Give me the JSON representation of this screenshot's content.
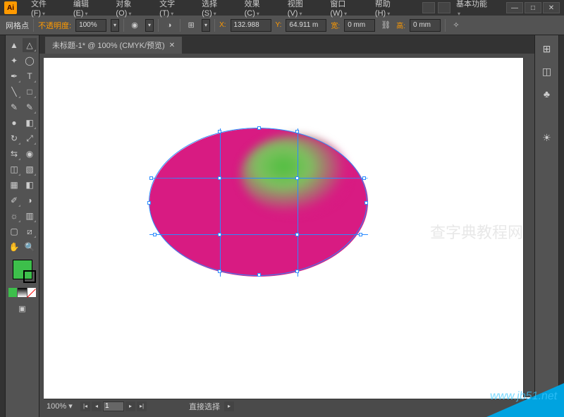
{
  "app": {
    "logo": "Ai",
    "workspace": "基本功能"
  },
  "menu": {
    "file": "文件(F)",
    "edit": "编辑(E)",
    "object": "对象(O)",
    "type": "文字(T)",
    "select": "选择(S)",
    "effect": "效果(C)",
    "view": "视图(V)",
    "window": "窗口(W)",
    "help": "帮助(H)"
  },
  "controlbar": {
    "mesh_label": "网格点",
    "opacity_label": "不透明度:",
    "opacity_value": "100%",
    "x_label": "X:",
    "x_value": "132.988",
    "y_label": "Y:",
    "y_value": "64.911 m",
    "w_label": "宽:",
    "w_value": "0 mm",
    "h_label": "高:",
    "h_value": "0 mm"
  },
  "tab": {
    "title": "未标题-1* @ 100% (CMYK/预览)"
  },
  "status": {
    "zoom": "100%",
    "artboard": "1",
    "tool": "直接选择"
  },
  "colors": {
    "fill": "#3dbf4b",
    "shape": "#d81b82",
    "mesh": "#4fbf3f"
  },
  "icons": {
    "selection": "▲",
    "direct": "△",
    "wand": "✦",
    "lasso": "◯",
    "pen": "✒",
    "type": "T",
    "line": "╲",
    "rect": "□",
    "brush": "✎",
    "pencil": "✎",
    "blob": "●",
    "eraser": "◧",
    "rotate": "↻",
    "scale": "⤢",
    "width": "⇆",
    "warp": "◉",
    "shapebuilder": "◫",
    "perspective": "▧",
    "mesh": "▦",
    "gradient": "◧",
    "eyedrop": "✐",
    "blend": "◑",
    "symbol": "☼",
    "graph": "▥",
    "artboard": "▢",
    "slice": "⧄",
    "hand": "✋",
    "zoom": "🔍",
    "screen": "▣"
  },
  "panels": {
    "color": "⊞",
    "swatches": "◫",
    "libraries": "♣",
    "appearance": "☀"
  },
  "win": {
    "min": "—",
    "max": "□",
    "close": "✕"
  }
}
